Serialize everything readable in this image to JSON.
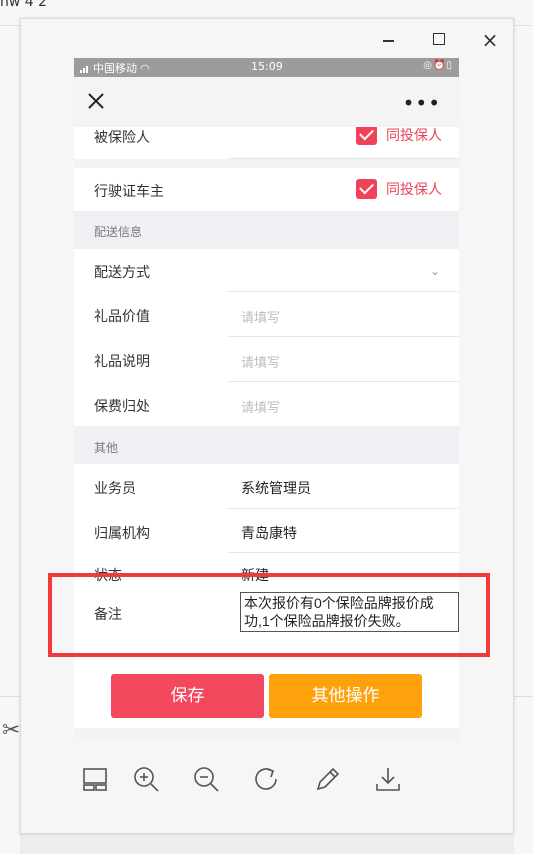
{
  "background": {
    "title_fragment": "hw 4 2"
  },
  "window": {
    "minimize_label": "",
    "maximize_label": "",
    "close_label": "×"
  },
  "statusbar": {
    "carrier": "中国移动",
    "time": "15:09"
  },
  "form": {
    "insured": {
      "label": "被保险人",
      "check_label": "同投保人"
    },
    "owner": {
      "label": "行驶证车主",
      "check_label": "同投保人"
    },
    "section_delivery": "配送信息",
    "delivery_method": {
      "label": "配送方式",
      "value": ""
    },
    "gift_value": {
      "label": "礼品价值",
      "placeholder": "请填写"
    },
    "gift_desc": {
      "label": "礼品说明",
      "placeholder": "请填写"
    },
    "fee_owner": {
      "label": "保费归处",
      "placeholder": "请填写"
    },
    "section_other": "其他",
    "salesman": {
      "label": "业务员",
      "value": "系统管理员"
    },
    "org": {
      "label": "归属机构",
      "value": "青岛康特"
    },
    "status": {
      "label": "状态",
      "value": "新建"
    },
    "remark": {
      "label": "备注",
      "value": "本次报价有0个保险品牌报价成功,1个保险品牌报价失败。"
    }
  },
  "buttons": {
    "save": "保存",
    "other": "其他操作"
  },
  "colors": {
    "accent_red": "#f4495c",
    "accent_orange": "#ffa10b",
    "highlight": "#f23a3a"
  },
  "toolbar_icons": [
    "layout-icon",
    "zoom-in-icon",
    "zoom-out-icon",
    "rotate-icon",
    "edit-icon",
    "download-icon"
  ]
}
